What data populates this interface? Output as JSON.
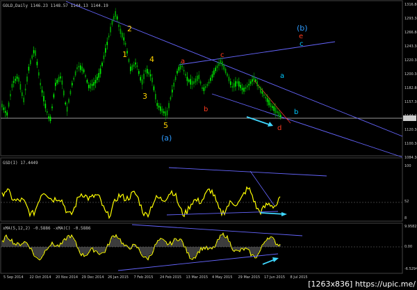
{
  "colors": {
    "background": "#000000",
    "bull_candle": "#00ff00",
    "bear_candle": "#00aa00",
    "oscillator": "#ffff00",
    "trendline": "#6666ff",
    "wave_yellow": "#ffd400",
    "wave_red": "#ff3b1f",
    "wave_cyan": "#00c8ff",
    "wave_blue": "#2e9bff",
    "arrow": "#3fd7ff",
    "text": "#d0d0d0"
  },
  "header": {
    "main": "GOLD,Daily  1146.23 1148.57 1144.13 1144.19",
    "osc": "GSD(I) 17.4449",
    "macd": "xMA(5,12,2) -0.5886  -xMA(C) -0.5886"
  },
  "price_scale": [
    "1316.84",
    "1293.34",
    "1266.84",
    "1243.34",
    "1220.34",
    "1200.34",
    "1182.84",
    "1157.34",
    "1144.19",
    "1120.34",
    "1100.34",
    "1084.34"
  ],
  "osc_scale": [
    "100",
    "52",
    "8"
  ],
  "macd_scale": [
    "9.9582",
    "0.00",
    "-6.5294"
  ],
  "date_axis": [
    "5 Sep 2014",
    "22 Oct 2014",
    "20 Nov 2014",
    "29 Dec 2014",
    "26 Jan 2015",
    "7 Feb 2015",
    "24 Feb 2015",
    "13 Mar 2015",
    "4 May 2015",
    "29 Mar 2015",
    "17 Jun 2015",
    "8 Jul 2015"
  ],
  "wave_labels": {
    "w1": "1",
    "w2": "2",
    "w3": "3",
    "w4": "4",
    "w5": "5",
    "wa": "(a)",
    "ra": "a",
    "rb": "b",
    "rc": "c",
    "rd": "d",
    "re": "e",
    "ca": "a",
    "cb": "b",
    "cc": "c",
    "bb": "(b)"
  },
  "watermark": "[1263x836] https://upic.me/"
}
